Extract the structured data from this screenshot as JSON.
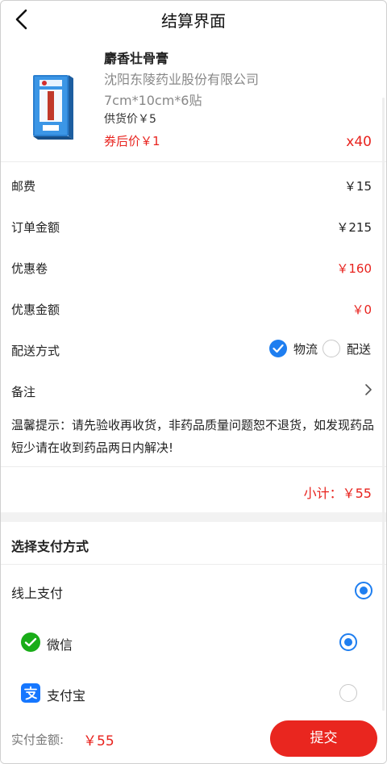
{
  "header": {
    "title": "结算界面"
  },
  "product": {
    "name": "麝香壮骨膏",
    "company": "沈阳东陵药业股份有限公司",
    "spec": "7cm*10cm*6贴",
    "supply_price": "供货价￥5",
    "coupon_price": "券后价￥1",
    "quantity": "x40"
  },
  "summary": {
    "postage_label": "邮费",
    "postage_value": "￥15",
    "order_label": "订单金额",
    "order_value": "￥215",
    "coupon_label": "优惠卷",
    "coupon_value": "￥160",
    "discount_label": "优惠金额",
    "discount_value": "￥0",
    "delivery_label": "配送方式",
    "delivery_options": [
      {
        "label": "物流",
        "selected": true
      },
      {
        "label": "配送",
        "selected": false
      }
    ],
    "remark_label": "备注",
    "tip": "温馨提示：请先验收再收货，非药品质量问题恕不退货，如发现药品短少请在收到药品两日内解决!",
    "subtotal": "小计：￥55"
  },
  "payment": {
    "title": "选择支付方式",
    "online_label": "线上支付",
    "online_selected": true,
    "methods": [
      {
        "label": "微信",
        "icon": "wechat-icon",
        "selected": true
      },
      {
        "label": "支付宝",
        "icon": "alipay-icon",
        "selected": false
      }
    ]
  },
  "footer": {
    "paid_label": "实付金额:",
    "paid_value": "￥55",
    "submit_label": "提交"
  },
  "colors": {
    "accent_red": "#e8231e",
    "accent_blue": "#1e7ef0",
    "wechat_green": "#1aad19",
    "alipay_blue": "#1677ff"
  }
}
